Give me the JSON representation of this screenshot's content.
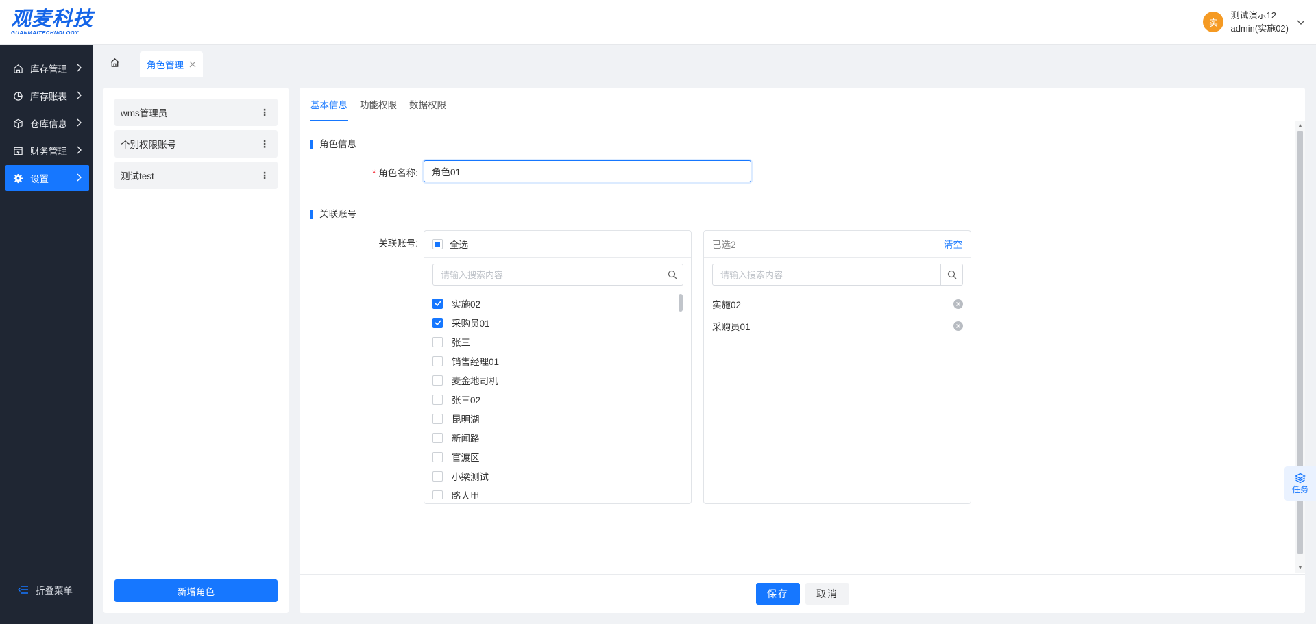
{
  "header": {
    "logo_main": "观麦科技",
    "logo_sub": "GUANMAITECHNOLOGY",
    "user": {
      "avatar_text": "实",
      "line1": "测试演示12",
      "line2": "admin(实施02)"
    }
  },
  "sidebar": {
    "items": [
      {
        "label": "库存管理",
        "icon": "home-icon",
        "active": false
      },
      {
        "label": "库存账表",
        "icon": "pie-chart-icon",
        "active": false
      },
      {
        "label": "仓库信息",
        "icon": "cube-icon",
        "active": false
      },
      {
        "label": "财务管理",
        "icon": "finance-icon",
        "active": false
      },
      {
        "label": "设置",
        "icon": "gear-icon",
        "active": true
      }
    ],
    "collapse_label": "折叠菜单"
  },
  "tabbar": {
    "tabs": [
      {
        "label": "角色管理",
        "active": true
      }
    ]
  },
  "roles": {
    "items": [
      "wms管理员",
      "个别权限账号",
      "测试test"
    ],
    "add_button": "新增角色"
  },
  "main": {
    "tabs": [
      "基本信息",
      "功能权限",
      "数据权限"
    ],
    "section_role_info": "角色信息",
    "role_name_label": "角色名称:",
    "role_name_value": "角色01",
    "section_accounts": "关联账号",
    "accounts_label": "关联账号:",
    "transfer_left": {
      "select_all_label": "全选",
      "search_placeholder": "请输入搜索内容",
      "items": [
        {
          "label": "实施02",
          "checked": true
        },
        {
          "label": "采购员01",
          "checked": true
        },
        {
          "label": "张三",
          "checked": false
        },
        {
          "label": "销售经理01",
          "checked": false
        },
        {
          "label": "麦金地司机",
          "checked": false
        },
        {
          "label": "张三02",
          "checked": false
        },
        {
          "label": "昆明湖",
          "checked": false
        },
        {
          "label": "新闻路",
          "checked": false
        },
        {
          "label": "官渡区",
          "checked": false
        },
        {
          "label": "小梁测试",
          "checked": false
        },
        {
          "label": "路人甲",
          "checked": false
        }
      ]
    },
    "transfer_right": {
      "selected_label": "已选2",
      "clear_label": "清空",
      "search_placeholder": "请输入搜索内容",
      "items": [
        "实施02",
        "采购员01"
      ]
    },
    "save_button": "保存",
    "cancel_button": "取消"
  },
  "task_widget": {
    "label": "任务"
  },
  "colors": {
    "accent": "#1677ff",
    "sidebar_bg": "#1f2633",
    "avatar_bg": "#f59a23"
  }
}
